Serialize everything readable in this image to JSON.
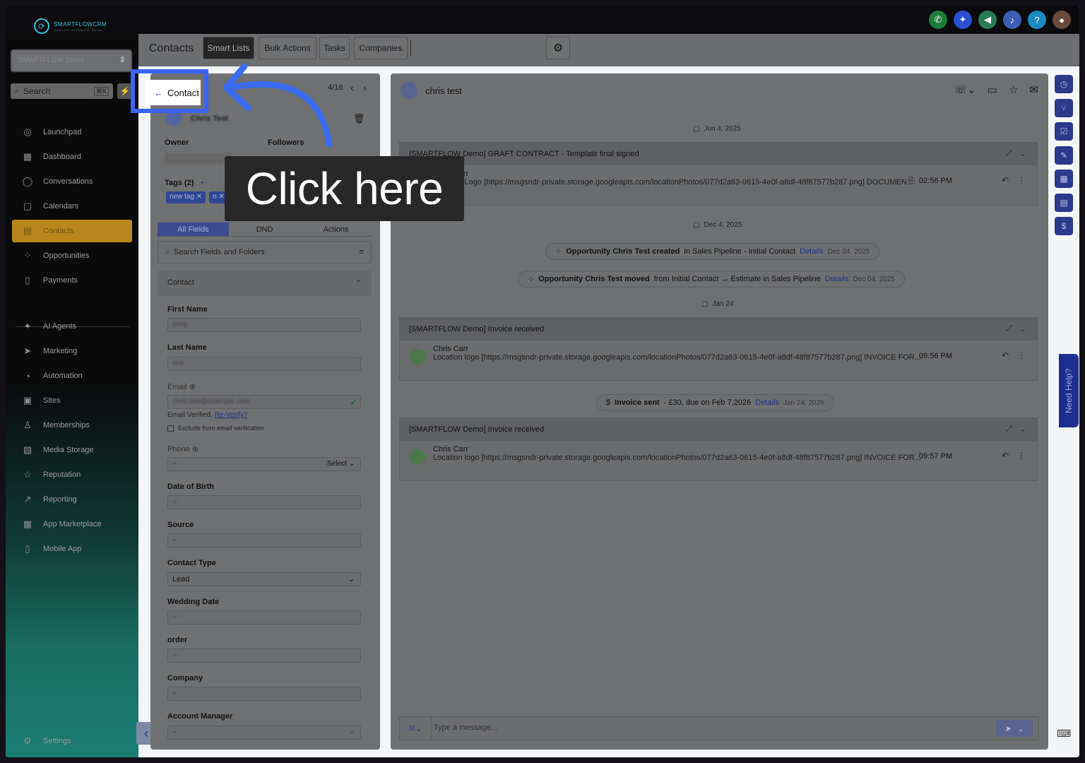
{
  "app": {
    "brand_name": "SMARTFLOWCRM",
    "brand_tagline": "SIMPLIFY. AUTOMATE. GROW",
    "location_name": "SMARTFLOW Demo"
  },
  "sidebar": {
    "search_label": "Search",
    "search_shortcut": "⌘K",
    "items": [
      {
        "label": "Launchpad",
        "icon": "launchpad-icon",
        "glyph": "◎"
      },
      {
        "label": "Dashboard",
        "icon": "dashboard-icon",
        "glyph": "▦"
      },
      {
        "label": "Conversations",
        "icon": "chat-icon",
        "glyph": "◯"
      },
      {
        "label": "Calendars",
        "icon": "calendar-icon",
        "glyph": "▢"
      },
      {
        "label": "Contacts",
        "icon": "contacts-icon",
        "glyph": "▤",
        "active": true
      },
      {
        "label": "Opportunities",
        "icon": "opportunities-icon",
        "glyph": "⁘"
      },
      {
        "label": "Payments",
        "icon": "payments-icon",
        "glyph": "▯"
      },
      {
        "label": "AI Agents",
        "icon": "sparkle-icon",
        "glyph": "✦"
      },
      {
        "label": "Marketing",
        "icon": "send-icon",
        "glyph": "➤"
      },
      {
        "label": "Automation",
        "icon": "automation-icon",
        "glyph": "◔"
      },
      {
        "label": "Sites",
        "icon": "sites-icon",
        "glyph": "▣"
      },
      {
        "label": "Memberships",
        "icon": "memberships-icon",
        "glyph": "♙"
      },
      {
        "label": "Media Storage",
        "icon": "image-icon",
        "glyph": "▨"
      },
      {
        "label": "Reputation",
        "icon": "star-icon",
        "glyph": "☆"
      },
      {
        "label": "Reporting",
        "icon": "trend-icon",
        "glyph": "↗"
      },
      {
        "label": "App Marketplace",
        "icon": "apps-icon",
        "glyph": "▦"
      },
      {
        "label": "Mobile App",
        "icon": "mobile-icon",
        "glyph": "▯"
      }
    ],
    "settings_label": "Settings"
  },
  "header": {
    "title": "Contacts",
    "tabs": [
      "Smart Lists",
      "Bulk Actions",
      "Tasks",
      "Companies"
    ]
  },
  "contact_panel": {
    "back_label": "Contact Details",
    "pager": "4/18",
    "contact_name": "Chris Test",
    "owner_label": "Owner",
    "followers_label": "Followers",
    "tags_label": "Tags (2)",
    "tags": [
      "new tag",
      "n"
    ],
    "field_tabs": [
      "All Fields",
      "DND",
      "Actions"
    ],
    "search_placeholder": "Search Fields and Folders",
    "section_title": "Contact",
    "fields": {
      "first_name_label": "First Name",
      "first_name_value": "chris",
      "last_name_label": "Last Name",
      "last_name_value": "test",
      "email_label": "Email",
      "email_value": "chris.test@example.com",
      "email_verified": "Email Verified.",
      "reverify": "Re-Verify?",
      "exclude_label": "Exclude from email verification",
      "phone_label": "Phone",
      "phone_value": "--",
      "phone_select": "Select",
      "dob_label": "Date of Birth",
      "dob_value": "--",
      "source_label": "Source",
      "source_value": "--",
      "contact_type_label": "Contact Type",
      "contact_type_value": "Lead",
      "wedding_label": "Wedding Date",
      "wedding_value": "--",
      "order_label": "order",
      "order_value": "--",
      "company_label": "Company",
      "company_value": "--",
      "account_manager_label": "Account Manager",
      "account_manager_value": "--"
    }
  },
  "conversation": {
    "contact_name": "chris test",
    "date1": "Jun 4, 2025",
    "card1_subject": "[SMARTFLOW Demo] GRAFT CONTRACT - Template final signed",
    "card1_from": "Chris Carr",
    "card1_msg": "Location Logo [https://msgsndr-private.storage.googleapis.com/locationPhotos/077d2a63-0615-4e0f-a8df-48f87577b287.png] DOCUMEN...",
    "card1_time": "02:56 PM",
    "date2": "Dec 4, 2025",
    "event1_title": "Opportunity Chris Test created",
    "event1_rest": "in Sales Pipeline - Initial Contact",
    "event1_link": "Details",
    "event1_date": "Dec 04, 2025",
    "event2_title": "Opportunity Chris Test moved",
    "event2_rest": "from Initial Contact → Estimate in Sales Pipeline",
    "event2_link": "Details",
    "event2_date": "Dec 04, 2025",
    "date3": "Jan 24",
    "card2_subject": "[SMARTFLOW Demo] Invoice received",
    "card2_from": "Chris Carr",
    "card2_msg": "Location logo [https://msgsndr-private.storage.googleapis.com/locationPhotos/077d2a63-0615-4e0f-a8df-48f87577b287.png] INVOICE FOR...",
    "card2_time": "09:56 PM",
    "event3_title": "Invoice sent",
    "event3_rest": "- £30, due on Feb 7,2026",
    "event3_link": "Details",
    "event3_date": "Jan 24, 2026",
    "card3_subject": "[SMARTFLOW Demo] Invoice received",
    "card3_from": "Chris Carr",
    "card3_msg": "Location logo [https://msgsndr-private.storage.googleapis.com/locationPhotos/077d2a63-0615-4e0f-a8df-48f87577b287.png] INVOICE FOR...",
    "card3_time": "09:57 PM",
    "composer_placeholder": "Type a message..."
  },
  "help": {
    "need_help": "Need Help?"
  },
  "overlay": {
    "callout_text": "Click here",
    "highlight_color": "#3c63f1"
  },
  "colors": {
    "active_nav": "#b8861c",
    "accent_blue": "#3c63f1"
  }
}
